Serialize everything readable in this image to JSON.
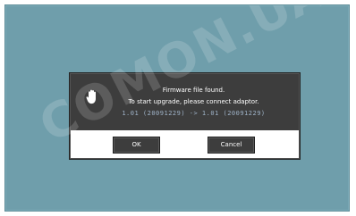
{
  "watermark": "COMON.UA",
  "dialog": {
    "icon": "hand-stop-icon",
    "line1": "Firmware file found.",
    "line2": "To start upgrade, please connect adaptor.",
    "line3": "1.01 (20091229) -> 1.01 (20091229)",
    "ok_label": "OK",
    "cancel_label": "Cancel"
  },
  "colors": {
    "screen_bg": "#6f9eab",
    "dialog_bg": "#3d3d3d",
    "button_bar_bg": "#ffffff"
  }
}
